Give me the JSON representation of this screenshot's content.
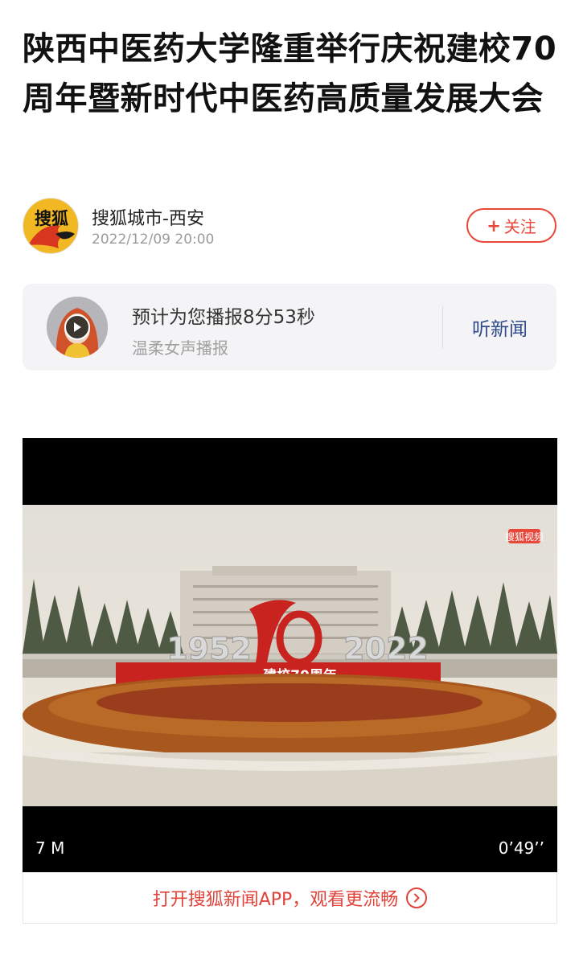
{
  "article": {
    "title": "陕西中医药大学隆重举行庆祝建校70周年暨新时代中医药高质量发展大会"
  },
  "author": {
    "avatar_text": "搜狐",
    "name": "搜狐城市-西安",
    "date": "2022/12/09 20:00",
    "follow_label": "关注",
    "follow_icon": "+",
    "brand_color": "#e8473a"
  },
  "audio": {
    "title": "预计为您播报8分53秒",
    "subtitle": "温柔女声播报",
    "listen_label": "听新闻",
    "play_icon": "play-icon"
  },
  "video": {
    "size": "7 M",
    "duration": "0’49’’",
    "watermark": "搜狐视频",
    "sign_text_left": "1952",
    "sign_text_right": "2022",
    "banner_text": "建校70周年"
  },
  "open_app": {
    "label": "打开搜狐新闻APP，观看更流畅",
    "icon": "chevron-right-circle-icon"
  }
}
